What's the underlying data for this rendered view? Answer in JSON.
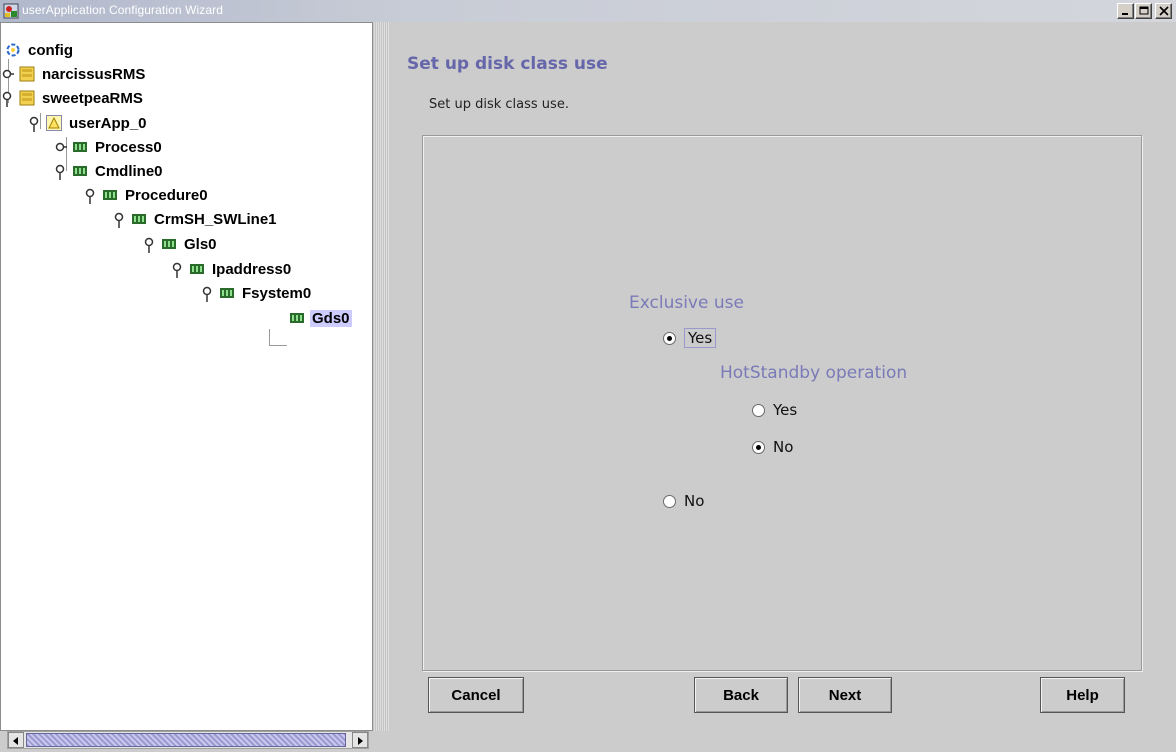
{
  "window": {
    "title": "userApplication Configuration Wizard",
    "title_color": "#ffffff"
  },
  "tree": {
    "nodes": [
      {
        "label": "config",
        "icon": "config-icon",
        "expanded": true
      },
      {
        "label": "narcissusRMS",
        "icon": "node-icon",
        "expanded": false
      },
      {
        "label": "sweetpeaRMS",
        "icon": "node-icon",
        "expanded": true
      },
      {
        "label": "userApp_0",
        "icon": "userapp-warning-icon",
        "expanded": true
      },
      {
        "label": "Process0",
        "icon": "resource-icon",
        "expanded": false
      },
      {
        "label": "Cmdline0",
        "icon": "resource-icon",
        "expanded": true
      },
      {
        "label": "Procedure0",
        "icon": "resource-icon",
        "expanded": true
      },
      {
        "label": "CrmSH_SWLine1",
        "icon": "resource-icon",
        "expanded": true
      },
      {
        "label": "Gls0",
        "icon": "resource-icon",
        "expanded": true
      },
      {
        "label": "Ipaddress0",
        "icon": "resource-icon",
        "expanded": true
      },
      {
        "label": "Fsystem0",
        "icon": "resource-icon",
        "expanded": true
      },
      {
        "label": "Gds0",
        "icon": "resource-icon",
        "selected": true
      }
    ]
  },
  "main": {
    "title": "Set up disk class use",
    "description": "Set up disk class use.",
    "exclusive_use": {
      "label": "Exclusive use",
      "options": [
        {
          "label": "Yes",
          "checked": true
        },
        {
          "label": "No",
          "checked": false
        }
      ]
    },
    "hotstandby": {
      "label": "HotStandby operation",
      "options": [
        {
          "label": "Yes",
          "checked": false
        },
        {
          "label": "No",
          "checked": true
        }
      ]
    }
  },
  "buttons": {
    "cancel": "Cancel",
    "back": "Back",
    "next": "Next",
    "help": "Help"
  },
  "colors": {
    "accent_label": "#7a7ab8",
    "title": "#6666aa",
    "selection": "#ccccff",
    "panel_bg": "#cccccc"
  }
}
